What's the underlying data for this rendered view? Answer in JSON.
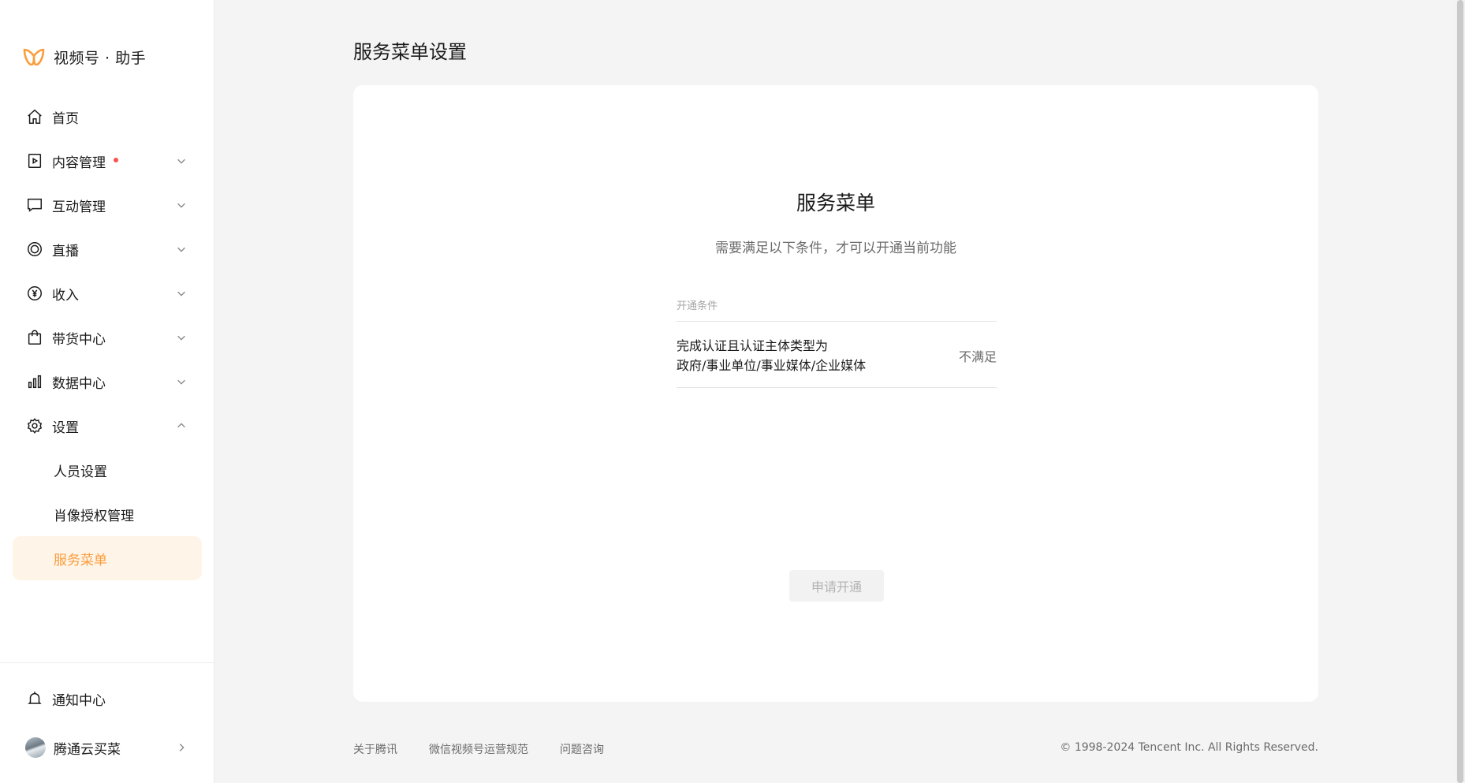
{
  "brand": {
    "name": "视频号 · 助手",
    "accent": "#fa9d3b"
  },
  "sidebar": {
    "items": [
      {
        "label": "首页",
        "icon": "home-icon"
      },
      {
        "label": "内容管理",
        "icon": "video-file-icon",
        "badge": "red-dot"
      },
      {
        "label": "互动管理",
        "icon": "chat-icon"
      },
      {
        "label": "直播",
        "icon": "live-icon"
      },
      {
        "label": "收入",
        "icon": "yen-icon"
      },
      {
        "label": "带货中心",
        "icon": "shopping-bag-icon"
      },
      {
        "label": "数据中心",
        "icon": "bar-chart-icon"
      },
      {
        "label": "设置",
        "icon": "gear-icon"
      }
    ],
    "sub_items": [
      {
        "label": "人员设置"
      },
      {
        "label": "肖像授权管理"
      },
      {
        "label": "服务菜单"
      }
    ],
    "bottom": {
      "notifications_label": "通知中心",
      "account_name": "腾通云买菜"
    },
    "active_color": "#fa9d3b",
    "active_bg": "#fff4e8"
  },
  "page": {
    "title": "服务菜单设置"
  },
  "card": {
    "title": "服务菜单",
    "subtitle": "需要满足以下条件，才可以开通当前功能",
    "condition_header": "开通条件",
    "conditions": [
      {
        "line1": "完成认证且认证主体类型为",
        "line2": "政府/事业单位/事业媒体/企业媒体",
        "status": "不满足"
      }
    ],
    "apply_button": "申请开通"
  },
  "footer": {
    "links": [
      "关于腾讯",
      "微信视频号运营规范",
      "问题咨询"
    ],
    "copyright": "© 1998-2024 Tencent Inc. All Rights Reserved."
  }
}
